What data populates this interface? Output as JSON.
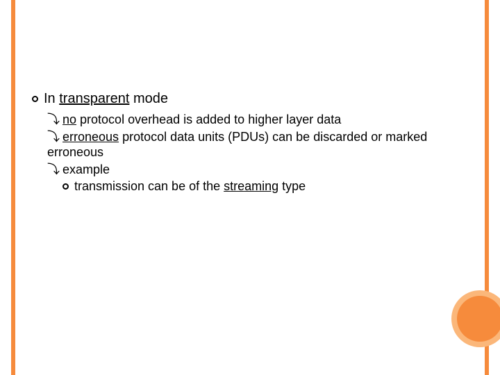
{
  "slide": {
    "level1": {
      "prefix": "In ",
      "underlined": "transparent",
      "suffix": " mode"
    },
    "level2_a": {
      "underlined": "no",
      "suffix": " protocol overhead is added to higher layer data"
    },
    "level2_b": {
      "underlined": "erroneous",
      "suffix": " protocol data units (PDUs) can be discarded or marked erroneous"
    },
    "level2_c": {
      "text": "example"
    },
    "level3_a": {
      "prefix": "transmission can be of the ",
      "underlined": "streaming",
      "suffix": " type"
    }
  }
}
